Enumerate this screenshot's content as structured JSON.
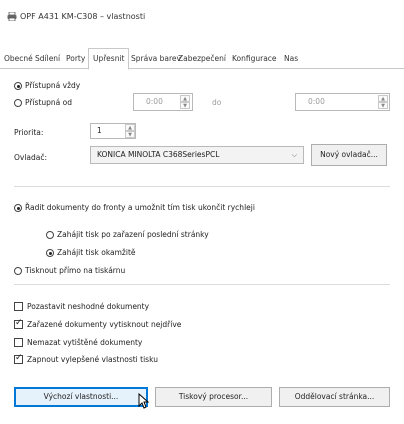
{
  "window": {
    "title": "OPF A431 KM-C308 – vlastnosti",
    "icon": "printer-icon"
  },
  "tabs": [
    "Obecné",
    "Sdílení",
    "Porty",
    "Upřesnit",
    "Správa barev",
    "Zabezpečení",
    "Konfigurace",
    "Nas"
  ],
  "active_tab": "Upřesnit",
  "availability": {
    "always_label": "Přístupná vždy",
    "always_selected": true,
    "from_label": "Přístupná od",
    "from_value": "0:00",
    "to_label": "do",
    "to_value": "0:00"
  },
  "priority": {
    "label": "Priorita:",
    "value": "1"
  },
  "driver": {
    "label": "Ovladač:",
    "value": "KONICA MINOLTA C368SeriesPCL",
    "new_driver_button": "Nový ovladač..."
  },
  "spool": {
    "spool_label": "Řadit dokumenty do fronty a umožnit tím tisk ukončit rychleji",
    "spool_selected": true,
    "after_last_page_label": "Zahájit tisk po zařazení poslední stránky",
    "after_last_page_selected": false,
    "immediately_label": "Zahájit tisk okamžitě",
    "immediately_selected": true,
    "direct_label": "Tisknout přímo na tiskárnu",
    "direct_selected": false
  },
  "options": [
    {
      "label": "Pozastavit neshodné dokumenty",
      "checked": false
    },
    {
      "label": "Zařazené dokumenty vytisknout nejdříve",
      "checked": true
    },
    {
      "label": "Nemazat vytištěné dokumenty",
      "checked": false
    },
    {
      "label": "Zapnout vylepšené vlastnosti tisku",
      "checked": true
    }
  ],
  "buttons": {
    "defaults": "Výchozí vlastnosti...",
    "processor": "Tiskový procesor...",
    "separator_page": "Oddělovací stránka..."
  }
}
